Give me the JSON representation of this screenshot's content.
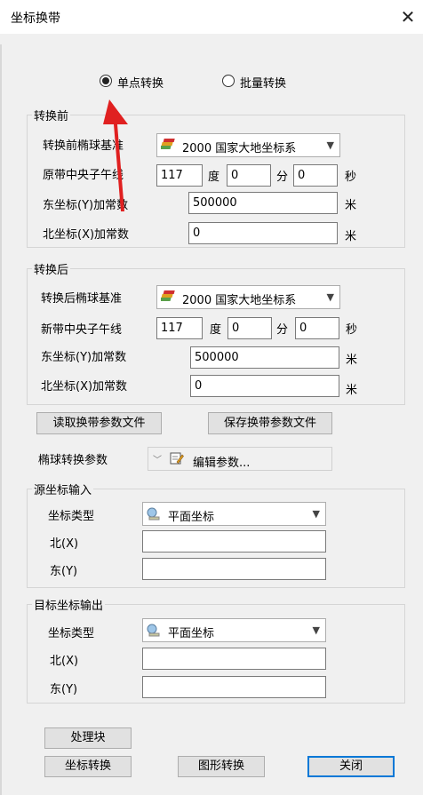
{
  "window": {
    "title": "坐标换带"
  },
  "mode": {
    "options": [
      "单点转换",
      "批量转换"
    ],
    "selected": 0
  },
  "before": {
    "title": "转换前",
    "ellipsoid_label": "转换前椭球基准",
    "ellipsoid_value": "2000  国家大地坐标系",
    "meridian_label": "原带中央子午线",
    "deg": "117",
    "deg_unit": "度",
    "min": "0",
    "min_unit": "分",
    "sec": "0",
    "sec_unit": "秒",
    "east_label": "东坐标(Y)加常数",
    "east_value": "500000",
    "east_unit": "米",
    "north_label": "北坐标(X)加常数",
    "north_value": "0",
    "north_unit": "米"
  },
  "after": {
    "title": "转换后",
    "ellipsoid_label": "转换后椭球基准",
    "ellipsoid_value": "2000  国家大地坐标系",
    "meridian_label": "新带中央子午线",
    "deg": "117",
    "deg_unit": "度",
    "min": "0",
    "min_unit": "分",
    "sec": "0",
    "sec_unit": "秒",
    "east_label": "东坐标(Y)加常数",
    "east_value": "500000",
    "east_unit": "米",
    "north_label": "北坐标(X)加常数",
    "north_value": "0",
    "north_unit": "米"
  },
  "buttons": {
    "read_params": "读取换带参数文件",
    "save_params": "保存换带参数文件",
    "process_block": "处理块",
    "coord_convert": "坐标转换",
    "graphic_convert": "图形转换",
    "close": "关闭"
  },
  "ellipsoid_params": {
    "label": "椭球转换参数",
    "edit": "编辑参数..."
  },
  "source": {
    "title": "源坐标输入",
    "type_label": "坐标类型",
    "type_value": "平面坐标",
    "north_label": "北(X)",
    "north_value": "",
    "east_label": "东(Y)",
    "east_value": ""
  },
  "target": {
    "title": "目标坐标输出",
    "type_label": "坐标类型",
    "type_value": "平面坐标",
    "north_label": "北(X)",
    "north_value": "",
    "east_label": "东(Y)",
    "east_value": ""
  },
  "colors": {
    "arrow": "#e02020",
    "dialog_bg": "#f0f0f0"
  }
}
